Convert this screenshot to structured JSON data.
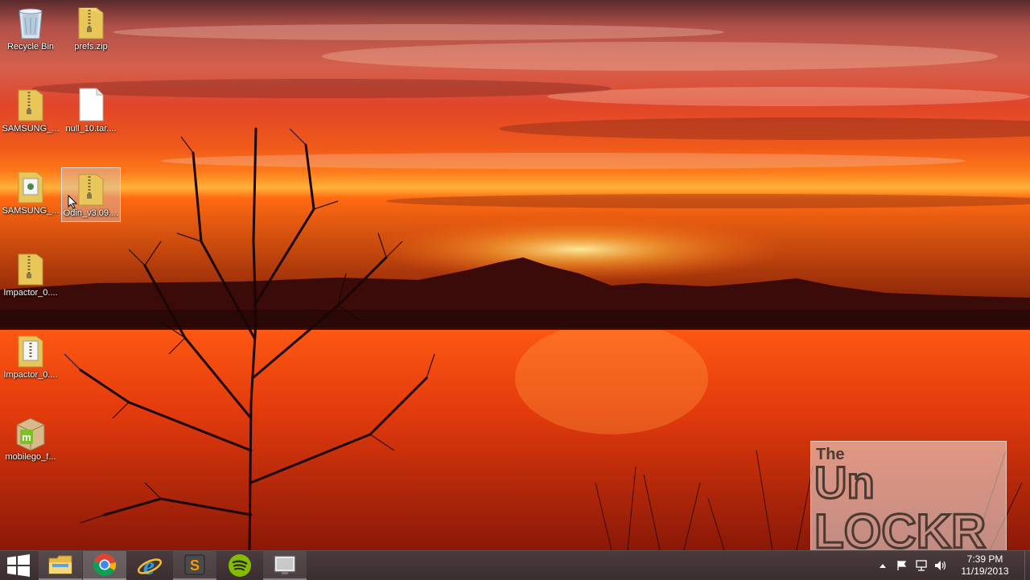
{
  "desktop": {
    "icons": [
      {
        "label": "Recycle Bin",
        "icon": "recycle-bin-icon"
      },
      {
        "label": "prefs.zip",
        "icon": "zip-folder-icon"
      },
      {
        "label": "SAMSUNG_...",
        "icon": "zip-folder-icon"
      },
      {
        "label": "null_10.tar....",
        "icon": "blank-file-icon"
      },
      {
        "label": "SAMSUNG_...",
        "icon": "zip-folder-icon"
      },
      {
        "label": "Odin_v3.09....",
        "icon": "zip-folder-icon"
      },
      {
        "label": "Impactor_0....",
        "icon": "zip-folder-icon"
      },
      {
        "label": "Impactor_0....",
        "icon": "zip-folder-icon"
      },
      {
        "label": "mobilego_f...",
        "icon": "package-icon"
      }
    ]
  },
  "watermark": {
    "line1": "The",
    "line2": "Un",
    "line3": "LOCKR"
  },
  "taskbar": {
    "pinned": [
      {
        "name": "start-button"
      },
      {
        "name": "file-explorer-icon"
      },
      {
        "name": "chrome-icon"
      },
      {
        "name": "internet-explorer-icon"
      },
      {
        "name": "sublime-text-icon"
      },
      {
        "name": "spotify-icon"
      },
      {
        "name": "screen-recorder-icon"
      }
    ],
    "clock": {
      "time": "7:39 PM",
      "date": "11/19/2013"
    }
  },
  "colors": {
    "taskbar": "#3a2e31",
    "selection": "#c8d7eb",
    "folder": "#e8c65a"
  }
}
